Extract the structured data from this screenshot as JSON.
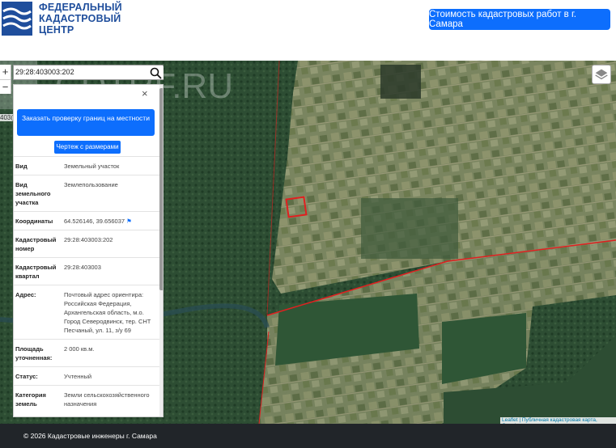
{
  "header": {
    "logo_line1": "ФЕДЕРАЛЬНЫЙ",
    "logo_line2": "КАДАСТРОВЫЙ",
    "logo_line3": "ЦЕНТР",
    "cta_label": "Стоимость кадастровых работ в г. Самара"
  },
  "map": {
    "search_value": "29:28:403003:202",
    "zoom_in": "+",
    "zoom_out": "−",
    "edge_label": "403(",
    "watermark": "CDTRF.RU",
    "attribution_link": "Leaflet",
    "attribution_text": " | Публичная кадастровая карта, Google"
  },
  "panel": {
    "close": "×",
    "order_button": "Заказать проверку границ на местности",
    "drawing_button": "Чертеж с размерами",
    "rows": [
      {
        "key": "Вид",
        "value": "Земельный участок"
      },
      {
        "key": "Вид земельного участка",
        "value": "Землепользование"
      },
      {
        "key": "Координаты",
        "value": "64.526146, 39.656037"
      },
      {
        "key": "Кадастровый номер",
        "value": "29:28:403003:202"
      },
      {
        "key": "Кадастровый квартал",
        "value": "29:28:403003"
      },
      {
        "key": "Адрес:",
        "value": "Почтовый адрес ориентира: Российская Федерация, Архангельская область, м.о. Город Северодвинск, тер. СНТ Песчаный, ул. 11, з/у 69"
      },
      {
        "key": "Площадь уточненная:",
        "value": "2 000 кв.м."
      },
      {
        "key": "Статус:",
        "value": "Учтенный"
      },
      {
        "key": "Категория земель",
        "value": "Земли сельскохозяйственного назначения"
      }
    ]
  },
  "footer": {
    "text": "© 2026 Кадастровые инженеры г. Самара"
  },
  "colors": {
    "brand": "#1f4e9c",
    "accent": "#0d6efd",
    "footer_bg": "#212529",
    "forest": "#27482e",
    "parcel_outline": "#e02020"
  }
}
